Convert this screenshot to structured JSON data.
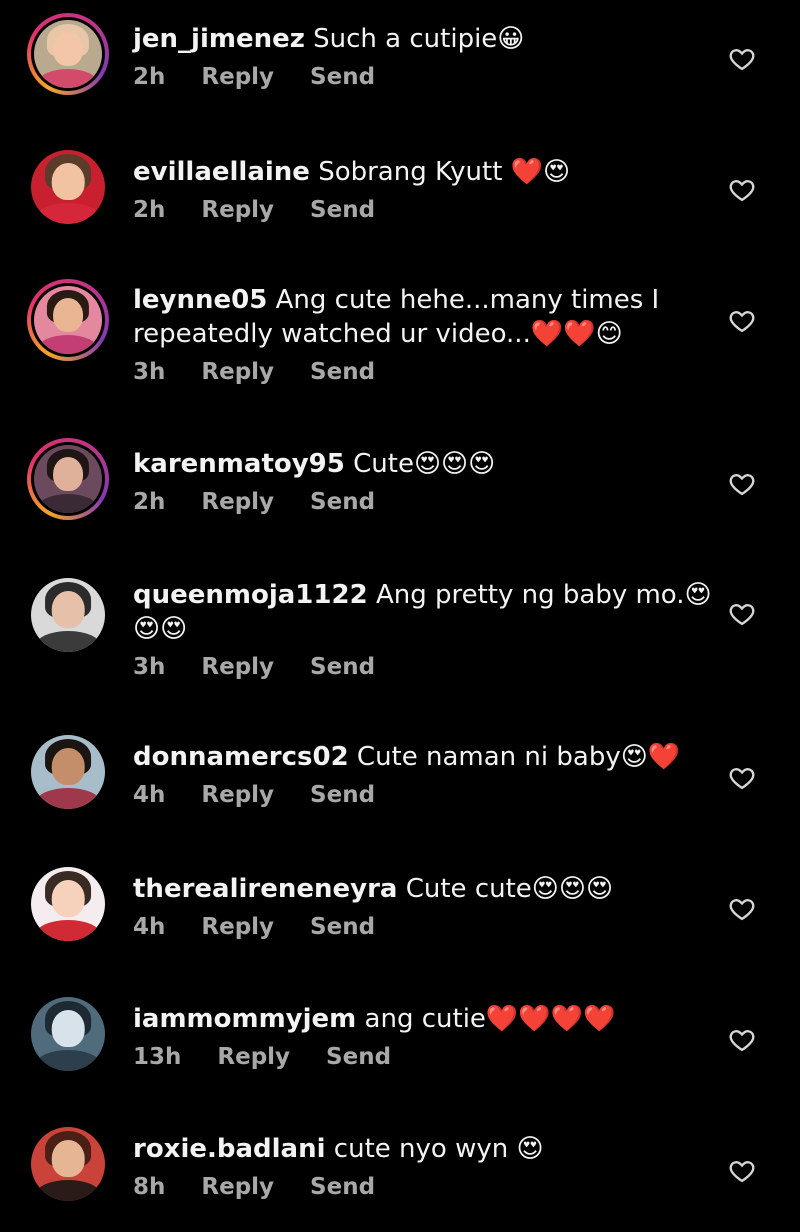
{
  "comments": [
    {
      "username": "jen_jimenez",
      "text": "Such a cutipie",
      "emojis": "😀",
      "text2": "",
      "time": "2h",
      "reply": "Reply",
      "send": "Send",
      "ring": true,
      "colors": {
        "bg": "#b9a98f",
        "hair": "#e8c7a8",
        "skin": "#f2c6a6",
        "body": "#d24b6a"
      }
    },
    {
      "username": "evillaellaine",
      "text": "Sobrang Kyutt ",
      "emojis": "❤️😍",
      "text2": "",
      "time": "2h",
      "reply": "Reply",
      "send": "Send",
      "ring": false,
      "colors": {
        "bg": "#c8202e",
        "hair": "#5b3b2a",
        "skin": "#f1c3a3",
        "body": "#d6263a"
      }
    },
    {
      "username": "leynne05",
      "text": "Ang cute hehe...many times I",
      "emojis": "",
      "text2": "repeatedly watched ur video...",
      "emojis2": "❤️❤️😊",
      "time": "3h",
      "reply": "Reply",
      "send": "Send",
      "ring": true,
      "colors": {
        "bg": "#e3889f",
        "hair": "#2a1a14",
        "skin": "#e9b593",
        "body": "#c23e73"
      }
    },
    {
      "username": "karenmatoy95",
      "text": "Cute",
      "emojis": "😍😍😍",
      "text2": "",
      "time": "2h",
      "reply": "Reply",
      "send": "Send",
      "ring": true,
      "colors": {
        "bg": "#6b4a5e",
        "hair": "#1f1515",
        "skin": "#e0b19a",
        "body": "#3a2a35"
      }
    },
    {
      "username": "queenmoja1122",
      "text": "Ang pretty ng baby mo.",
      "emojis": "😍",
      "text2": "",
      "emojis2": "😍😍",
      "time": "3h",
      "reply": "Reply",
      "send": "Send",
      "ring": false,
      "colors": {
        "bg": "#d9d9d9",
        "hair": "#2b2b2b",
        "skin": "#e6c0a8",
        "body": "#3b3b3b"
      }
    },
    {
      "username": "donnamercs02",
      "text": "Cute naman ni baby",
      "emojis": "😍❤️",
      "text2": "",
      "time": "4h",
      "reply": "Reply",
      "send": "Send",
      "ring": false,
      "colors": {
        "bg": "#a7bdc9",
        "hair": "#1a1412",
        "skin": "#c48e6a",
        "body": "#a0384c"
      }
    },
    {
      "username": "therealireneneyra",
      "text": "Cute cute",
      "emojis": "😍😍😍",
      "text2": "",
      "time": "4h",
      "reply": "Reply",
      "send": "Send",
      "ring": false,
      "colors": {
        "bg": "#f4ecef",
        "hair": "#3a2a24",
        "skin": "#f6d2bd",
        "body": "#d02a34"
      }
    },
    {
      "username": "iammommyjem",
      "text": "ang cutie",
      "emojis": "❤️❤️❤️❤️",
      "text2": "",
      "time": "13h",
      "reply": "Reply",
      "send": "Send",
      "ring": false,
      "colors": {
        "bg": "#4f6b7c",
        "hair": "#1d2a33",
        "skin": "#d8e2ea",
        "body": "#2d3f4b"
      }
    },
    {
      "username": "roxie.badlani",
      "text": "cute nyo wyn ",
      "emojis": "😍",
      "text2": "",
      "time": "8h",
      "reply": "Reply",
      "send": "Send",
      "ring": false,
      "colors": {
        "bg": "#c9433a",
        "hair": "#4a1f16",
        "skin": "#e6b594",
        "body": "#2a1a18"
      }
    }
  ]
}
